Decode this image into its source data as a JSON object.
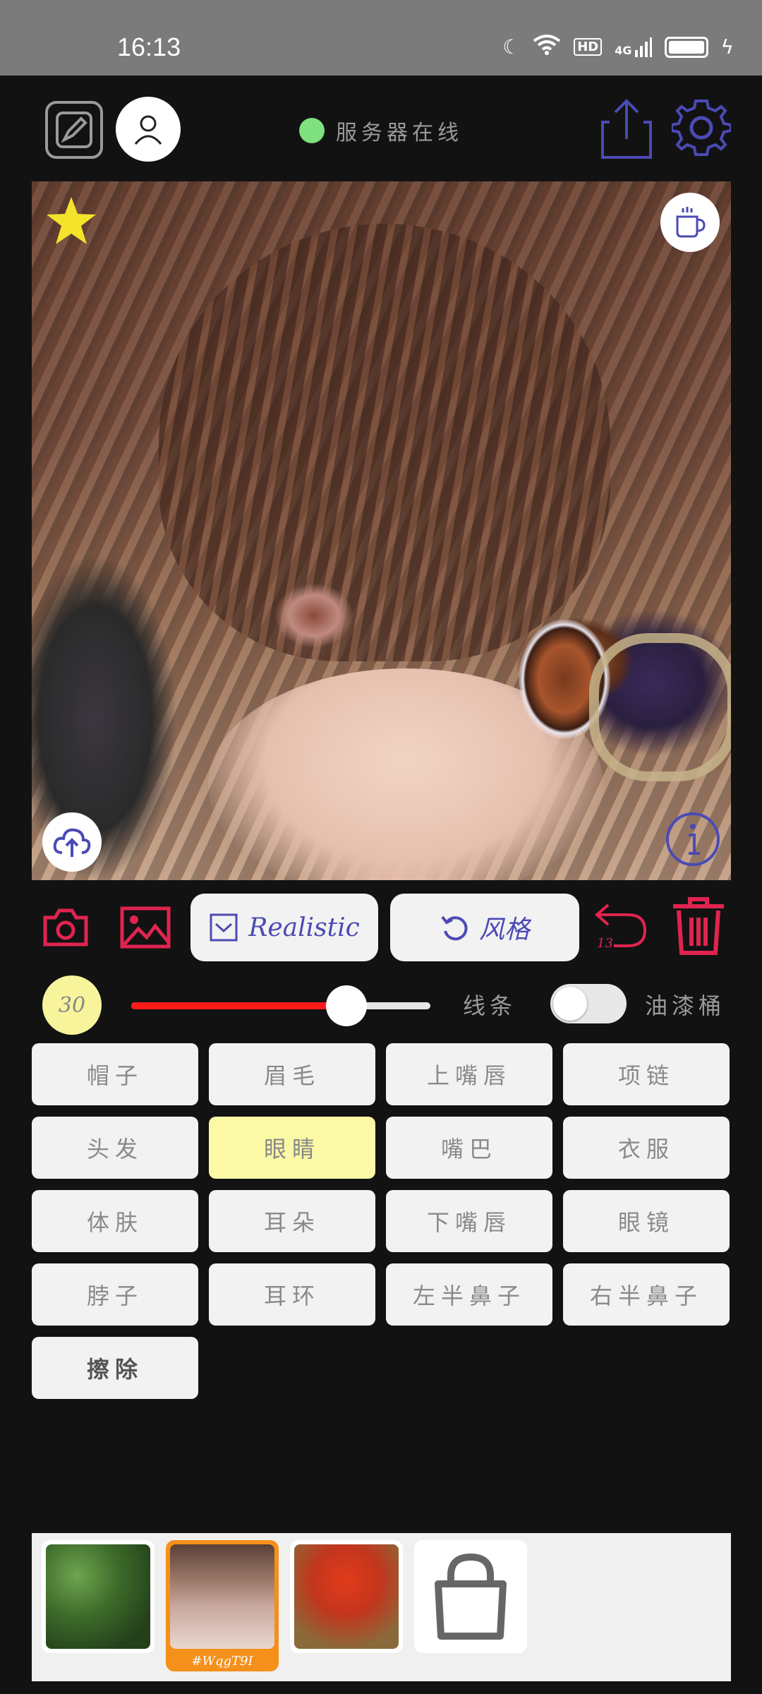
{
  "status_bar": {
    "time": "16:13",
    "network": "4G",
    "hd": "HD"
  },
  "header": {
    "server_status": "服务器在线"
  },
  "toolbar": {
    "model_label": "Realistic",
    "style_label": "风格",
    "undo_count": "13"
  },
  "controls": {
    "brush_size": "30",
    "slider_value_percent": 72,
    "lines_label": "线条",
    "bucket_label": "油漆桶",
    "bucket_enabled": false
  },
  "parts": [
    {
      "label": "帽子",
      "selected": false
    },
    {
      "label": "眉毛",
      "selected": false
    },
    {
      "label": "上嘴唇",
      "selected": false
    },
    {
      "label": "项链",
      "selected": false
    },
    {
      "label": "头发",
      "selected": false
    },
    {
      "label": "眼睛",
      "selected": true
    },
    {
      "label": "嘴巴",
      "selected": false
    },
    {
      "label": "衣服",
      "selected": false
    },
    {
      "label": "体肤",
      "selected": false
    },
    {
      "label": "耳朵",
      "selected": false
    },
    {
      "label": "下嘴唇",
      "selected": false
    },
    {
      "label": "眼镜",
      "selected": false
    },
    {
      "label": "脖子",
      "selected": false
    },
    {
      "label": "耳环",
      "selected": false
    },
    {
      "label": "左半鼻子",
      "selected": false
    },
    {
      "label": "右半鼻子",
      "selected": false
    },
    {
      "label": "擦除",
      "selected": false
    }
  ],
  "thumbnails": {
    "active_code": "#WqgT9I"
  },
  "colors": {
    "accent_red": "#e0244f",
    "accent_blue": "#4b4ab5",
    "selected_yellow": "#fbf8a6",
    "active_orange": "#f5901a"
  }
}
